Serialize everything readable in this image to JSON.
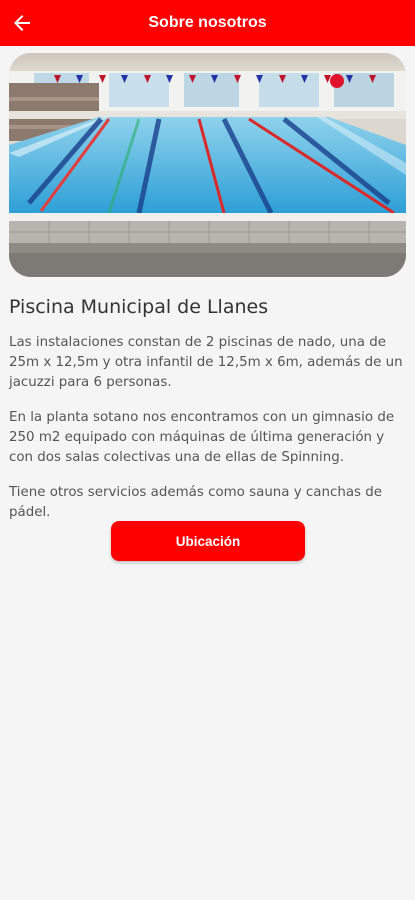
{
  "appbar": {
    "title": "Sobre nosotros",
    "back_icon": "arrow-left-icon",
    "color": "#ff0000"
  },
  "content": {
    "heading": "Piscina Municipal de Llanes",
    "paragraphs": [
      "Las instalaciones constan de 2 piscinas de nado, una de 25m x 12,5m y otra infantil de 12,5m x 6m, además de un jacuzzi para 6 personas.",
      "En la planta sotano nos encontramos con un gimnasio de 250 m2 equipado con máquinas de última generación y con dos salas colectivas una de ellas de Spinning.",
      "Tiene otros servicios además como sauna y canchas de pádel."
    ],
    "location_button": "Ubicación"
  }
}
